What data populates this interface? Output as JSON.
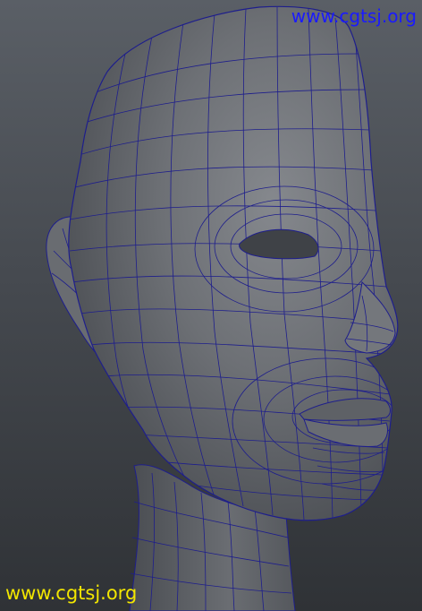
{
  "viewport": {
    "watermark_top": "www.cgtsj.org",
    "watermark_bottom": "www.cgtsj.org"
  },
  "model": {
    "name": "head-mesh",
    "wireframe_color": "#1e1e8c",
    "surface_color": "#6b6e73",
    "shadow_color": "#4a4d52",
    "highlight_color": "#8a8d92"
  },
  "colors": {
    "watermark_top_color": "#1a1aff",
    "watermark_bottom_color": "#f2e600"
  }
}
